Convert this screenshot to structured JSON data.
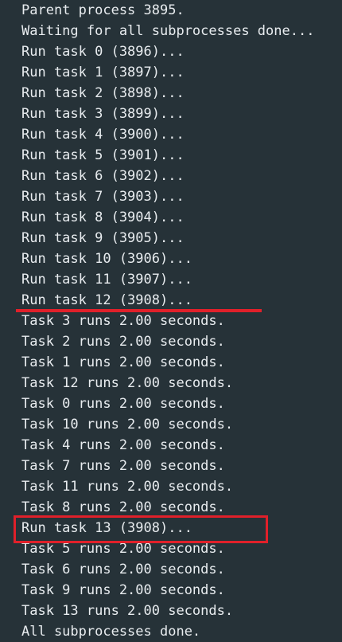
{
  "terminal": {
    "lines": [
      "Parent process 3895.",
      "Waiting for all subprocesses done...",
      "Run task 0 (3896)...",
      "Run task 1 (3897)...",
      "Run task 2 (3898)...",
      "Run task 3 (3899)...",
      "Run task 4 (3900)...",
      "Run task 5 (3901)...",
      "Run task 6 (3902)...",
      "Run task 7 (3903)...",
      "Run task 8 (3904)...",
      "Run task 9 (3905)...",
      "Run task 10 (3906)...",
      "Run task 11 (3907)...",
      "Run task 12 (3908)...",
      "Task 3 runs 2.00 seconds.",
      "Task 2 runs 2.00 seconds.",
      "Task 1 runs 2.00 seconds.",
      "Task 12 runs 2.00 seconds.",
      "Task 0 runs 2.00 seconds.",
      "Task 10 runs 2.00 seconds.",
      "Task 4 runs 2.00 seconds.",
      "Task 7 runs 2.00 seconds.",
      "Task 11 runs 2.00 seconds.",
      "Task 8 runs 2.00 seconds.",
      "Run task 13 (3908)...",
      "Task 5 runs 2.00 seconds.",
      "Task 6 runs 2.00 seconds.",
      "Task 9 runs 2.00 seconds.",
      "Task 13 runs 2.00 seconds.",
      "All subprocesses done."
    ]
  },
  "colors": {
    "background": "#263238",
    "text": "#e8ecef",
    "annotation": "#e0202a"
  }
}
